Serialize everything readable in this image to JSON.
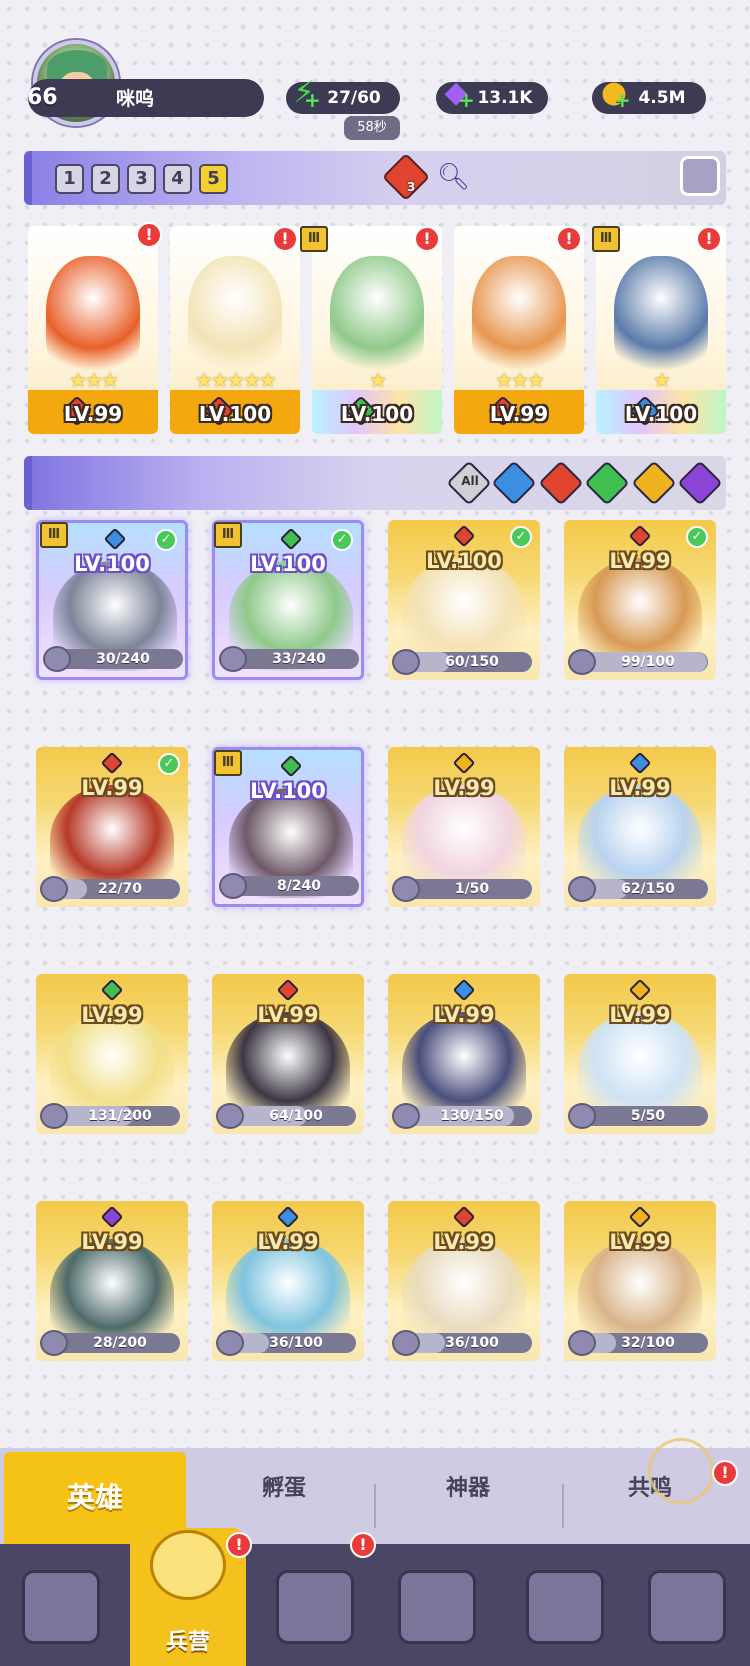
{
  "player": {
    "level": "66",
    "name": "咪呜"
  },
  "resources": {
    "energy": "27/60",
    "energy_timer": "58秒",
    "gems": "13.1K",
    "coins": "4.5M"
  },
  "team": {
    "slots": [
      "1",
      "2",
      "3",
      "4",
      "5"
    ],
    "active_slot": "5",
    "element_count": "3",
    "cards": [
      {
        "level": "LV.99",
        "stars": "★★★",
        "element": "#e2452f",
        "art": "#e8602a",
        "base": "orange"
      },
      {
        "level": "LV.100",
        "stars": "★★★★★",
        "element": "#e2452f",
        "art": "#f2e3b5",
        "base": "orange"
      },
      {
        "level": "LV.100",
        "stars": "★",
        "element": "#3fbf4f",
        "art": "#8fc98a",
        "base": "rainbow"
      },
      {
        "level": "LV.99",
        "stars": "★★★",
        "element": "#e2452f",
        "art": "#e79650",
        "base": "orange"
      },
      {
        "level": "LV.100",
        "stars": "★",
        "element": "#3c8fe0",
        "art": "#5a7aa8",
        "base": "rainbow"
      }
    ]
  },
  "filters": {
    "all_label": "All",
    "colors": [
      "#3c8fe0",
      "#e2452f",
      "#3fbf4f",
      "#f0b31e",
      "#8a44d6"
    ]
  },
  "heroes": [
    {
      "level": "LV.100",
      "stars": "★",
      "progress": "30/240",
      "fill": 0.125,
      "element": "#3c8fe0",
      "art": "#7d8599",
      "style": "purple",
      "check": true
    },
    {
      "level": "LV.100",
      "stars": "★",
      "progress": "33/240",
      "fill": 0.1375,
      "element": "#3fbf4f",
      "art": "#8fc98a",
      "style": "purple",
      "check": true
    },
    {
      "level": "LV.100",
      "stars": "★★★★★",
      "progress": "60/150",
      "fill": 0.4,
      "element": "#e2452f",
      "art": "#f3e2b6",
      "style": "gold",
      "check": true
    },
    {
      "level": "LV.99",
      "stars": "★★★",
      "progress": "99/100",
      "fill": 0.99,
      "element": "#e2452f",
      "art": "#d89a55",
      "style": "gold",
      "check": true
    },
    {
      "level": "LV.99",
      "stars": "★★★",
      "progress": "22/70",
      "fill": 0.314,
      "element": "#e2452f",
      "art": "#b63a2a",
      "style": "gold",
      "check": true
    },
    {
      "level": "LV.100",
      "stars": "★",
      "progress": "8/240",
      "fill": 0.033,
      "element": "#3fbf4f",
      "art": "#6e5a68",
      "style": "purple",
      "check": false
    },
    {
      "level": "LV.99",
      "stars": "★★",
      "progress": "1/50",
      "fill": 0.02,
      "element": "#f0b31e",
      "art": "#f1d5e0",
      "style": "gold",
      "check": false
    },
    {
      "level": "LV.99",
      "stars": "★★★★★",
      "progress": "62/150",
      "fill": 0.413,
      "element": "#3c8fe0",
      "art": "#b9d3ef",
      "style": "gold",
      "check": false
    },
    {
      "level": "LV.99",
      "stars": "★★★★★",
      "progress": "131/200",
      "fill": 0.655,
      "element": "#3fbf4f",
      "art": "#f1e08a",
      "style": "gold",
      "check": false
    },
    {
      "level": "LV.99",
      "stars": "★★★",
      "progress": "64/100",
      "fill": 0.64,
      "element": "#e2452f",
      "art": "#3d3743",
      "style": "gold",
      "check": false
    },
    {
      "level": "LV.99",
      "stars": "★★★★★",
      "progress": "130/150",
      "fill": 0.867,
      "element": "#3c8fe0",
      "art": "#4a4e7a",
      "style": "gold",
      "check": false
    },
    {
      "level": "LV.99",
      "stars": "★★",
      "progress": "5/50",
      "fill": 0.1,
      "element": "#f0b31e",
      "art": "#cfe2f5",
      "style": "gold",
      "check": false
    },
    {
      "level": "LV.99",
      "stars": "★★★★★",
      "progress": "28/200",
      "fill": 0.14,
      "element": "#8a44d6",
      "art": "#4e6a6a",
      "style": "gold",
      "check": false
    },
    {
      "level": "LV.99",
      "stars": "★★★",
      "progress": "36/100",
      "fill": 0.36,
      "element": "#3c8fe0",
      "art": "#7fc4df",
      "style": "gold",
      "check": false
    },
    {
      "level": "LV.99",
      "stars": "★★★★",
      "progress": "36/100",
      "fill": 0.36,
      "element": "#e2452f",
      "art": "#e9dcbf",
      "style": "gold",
      "check": false
    },
    {
      "level": "LV.99",
      "stars": "★★★★",
      "progress": "32/100",
      "fill": 0.32,
      "element": "#f0b31e",
      "art": "#d9b48a",
      "style": "gold",
      "check": false
    }
  ],
  "tabs": {
    "heroes": "英雄",
    "hatch": "孵蛋",
    "artifacts": "神器",
    "resonance": "共鸣"
  },
  "nav": {
    "barracks": "兵营"
  },
  "alert_glyph": "!"
}
